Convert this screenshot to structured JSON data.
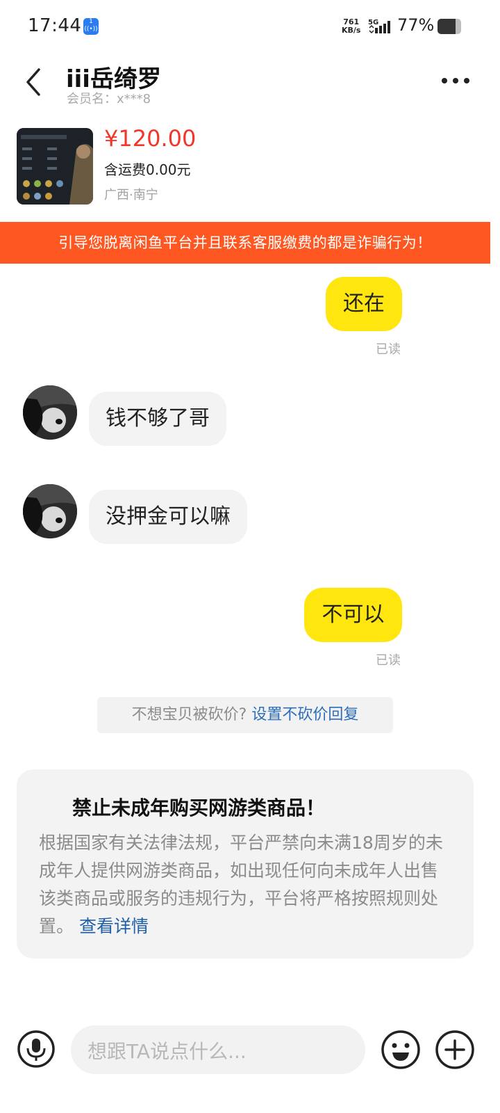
{
  "status_bar": {
    "time": "17:44",
    "badge": "1",
    "net_speed_value": "761",
    "net_speed_unit": "KB/s",
    "network": "5G",
    "battery_percent": "77%",
    "battery_level": 0.77
  },
  "header": {
    "name": "iii岳绮罗",
    "member": "会员名：x***8"
  },
  "product": {
    "price": "¥120.00",
    "shipping": "含运费0.00元",
    "location": "广西·南宁"
  },
  "warning": "引导您脱离闲鱼平台并且联系客服缴费的都是诈骗行为！",
  "messages": [
    {
      "from": "me",
      "text": "还在",
      "status": "已读"
    },
    {
      "from": "them",
      "text": "钱不够了哥"
    },
    {
      "from": "them",
      "text": "没押金可以嘛"
    },
    {
      "from": "me",
      "text": "不可以",
      "status": "已读"
    }
  ],
  "tip": {
    "text": "不想宝贝被砍价?",
    "link": "设置不砍价回复"
  },
  "notice": {
    "title": "禁止未成年购买网游类商品！",
    "body": "根据国家有关法律法规，平台严禁向未满18周岁的未成年人提供网游类商品，如出现任何向未成年人出售该类商品或服务的违规行为，平台将严格按照规则处置。",
    "link": "查看详情"
  },
  "input": {
    "placeholder": "想跟TA说点什么..."
  },
  "colors": {
    "accent_yellow": "#ffe60f",
    "warning_orange": "#ff5722",
    "price_red": "#f2362a",
    "link_blue": "#2d6dbd"
  },
  "icons": [
    "back-icon",
    "more-icon",
    "mic-icon",
    "emoji-icon",
    "plus-icon"
  ]
}
